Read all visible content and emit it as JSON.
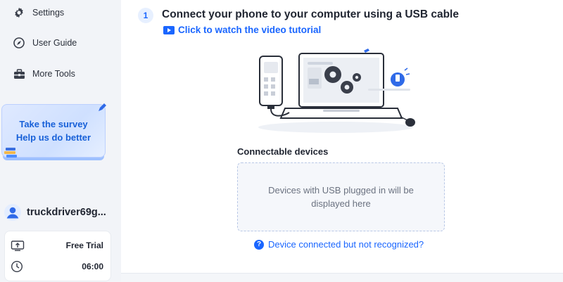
{
  "sidebar": {
    "items": [
      {
        "label": "Settings",
        "icon": "gear-icon"
      },
      {
        "label": "User Guide",
        "icon": "compass-icon"
      },
      {
        "label": "More Tools",
        "icon": "toolbox-icon"
      }
    ],
    "survey": {
      "line1": "Take the survey",
      "line2": "Help us do better"
    },
    "user": {
      "name": "truckdriver69g...",
      "icon": "user-avatar-icon"
    },
    "plan": {
      "label": "Free Trial",
      "icon": "upgrade-icon",
      "time": "06:00",
      "time_icon": "clock-icon"
    }
  },
  "main": {
    "step_number": "1",
    "step_title": "Connect your phone to your computer using a USB cable",
    "video_link": "Click to watch the video tutorial",
    "devices_label": "Connectable devices",
    "empty_line1": "Devices with USB plugged in will be",
    "empty_line2": "displayed here",
    "help_icon": "?",
    "help_link": "Device connected but not recognized?"
  },
  "colors": {
    "accent": "#1a66ff",
    "sidebar_bg": "#f2f4f8",
    "dropzone_bg": "#f5f7fb"
  }
}
